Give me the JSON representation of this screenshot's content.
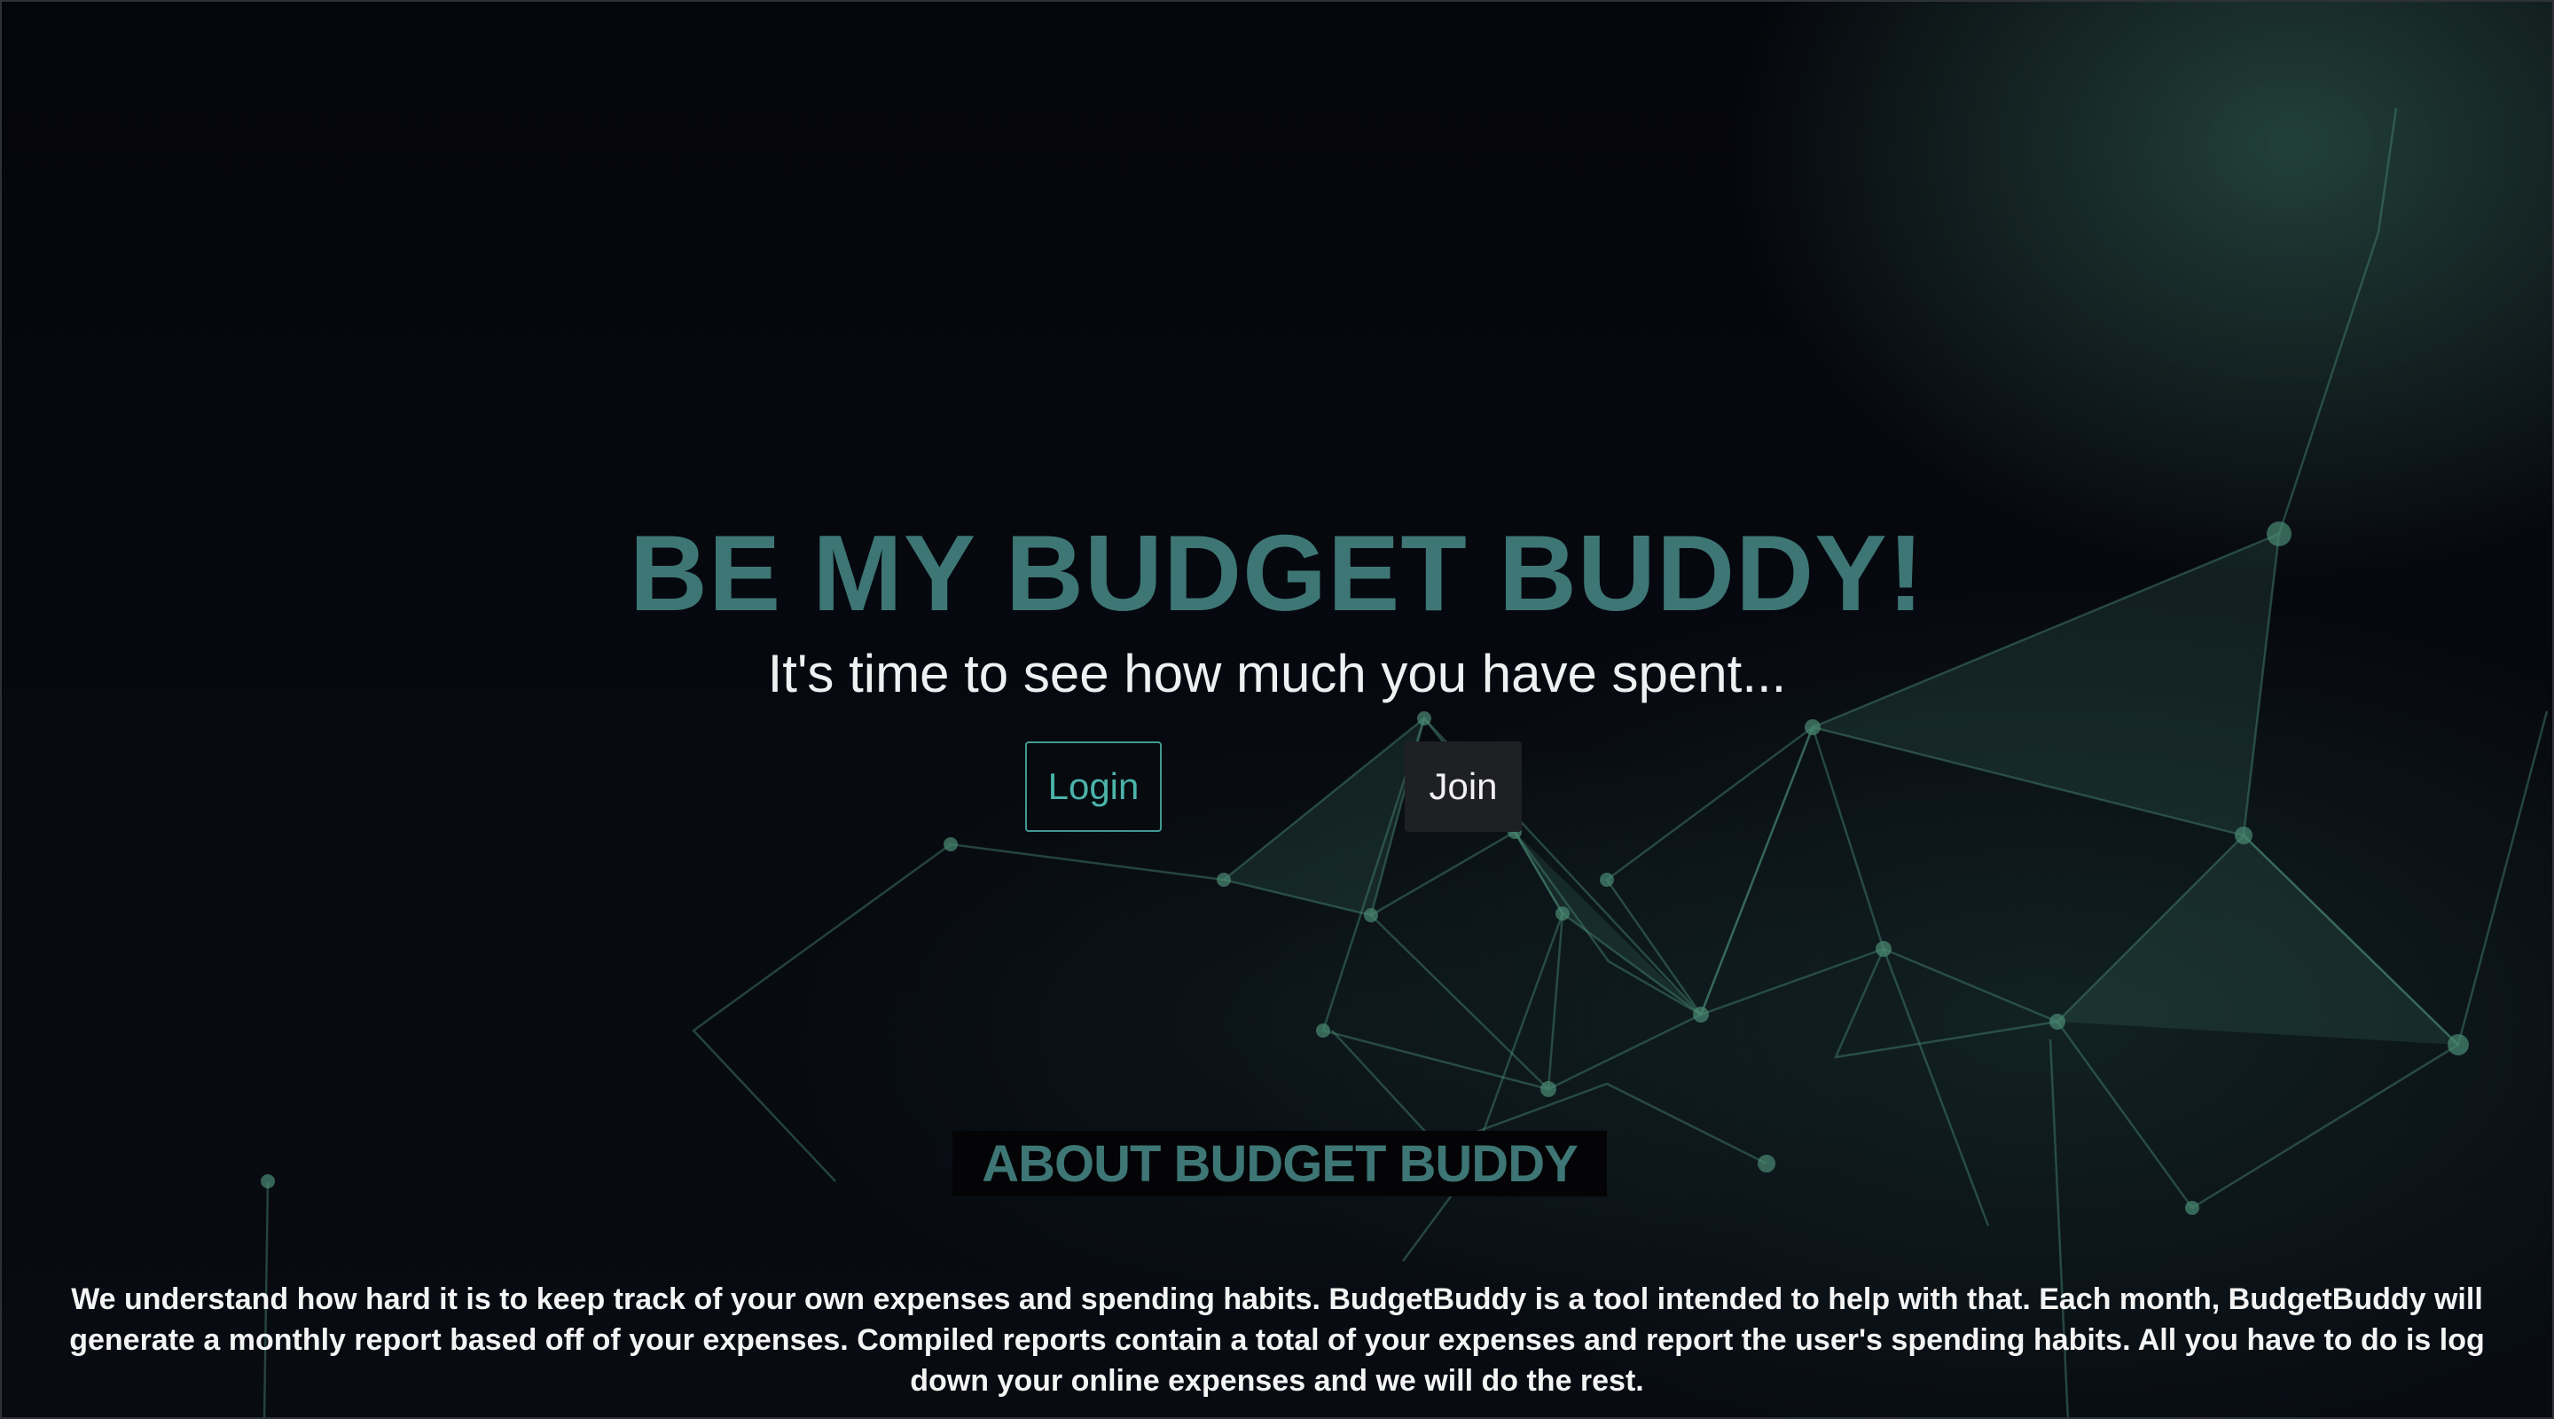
{
  "hero": {
    "title": "BE MY BUDGET BUDDY!",
    "subtitle": "It's time to see how much you have spent..."
  },
  "buttons": {
    "login_label": "Login",
    "join_label": "Join"
  },
  "about": {
    "title": "ABOUT BUDGET BUDDY",
    "text": "We understand how hard it is to keep track of your own expenses and spending habits. BudgetBuddy is a tool intended to help with that. Each month, BudgetBuddy will generate a monthly report based off of your expenses. Compiled reports contain a total of your expenses and report the user's spending habits. All you have to do is log down your online expenses and we will do the rest."
  },
  "colors": {
    "accent": "#3d7675",
    "login_border": "#3f9a93",
    "join_background": "#1e2024",
    "background": "#06070d",
    "network_lines": "#3a6e5e"
  }
}
